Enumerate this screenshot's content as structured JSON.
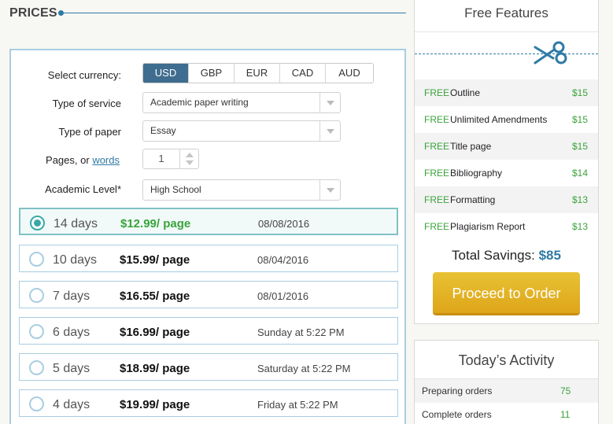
{
  "prices": {
    "title": "PRICES"
  },
  "form": {
    "currency_label": "Select currency:",
    "currencies": [
      "USD",
      "GBP",
      "EUR",
      "CAD",
      "AUD"
    ],
    "selected_currency": "USD",
    "service_label": "Type of service",
    "service_value": "Academic paper writing",
    "paper_label": "Type of paper",
    "paper_value": "Essay",
    "pages_label": "Pages, or",
    "pages_link": "words",
    "pages_value": "1",
    "level_label": "Academic Level*",
    "level_value": "High School"
  },
  "deadlines": [
    {
      "days": "14 days",
      "price": "$12.99/ page",
      "date": "08/08/2016",
      "selected": true
    },
    {
      "days": "10 days",
      "price": "$15.99/ page",
      "date": "08/04/2016",
      "selected": false
    },
    {
      "days": "7 days",
      "price": "$16.55/ page",
      "date": "08/01/2016",
      "selected": false
    },
    {
      "days": "6 days",
      "price": "$16.99/ page",
      "date": "Sunday at 5:22 PM",
      "selected": false
    },
    {
      "days": "5 days",
      "price": "$18.99/ page",
      "date": "Saturday at 5:22 PM",
      "selected": false
    },
    {
      "days": "4 days",
      "price": "$19.99/ page",
      "date": "Friday at 5:22 PM",
      "selected": false
    }
  ],
  "features": {
    "title": "Free Features",
    "icon": "scissors-icon",
    "items": [
      {
        "free": "FREE",
        "name": "Outline",
        "price": "$15"
      },
      {
        "free": "FREE",
        "name": "Unlimited Amendments",
        "price": "$15"
      },
      {
        "free": "FREE",
        "name": "Title page",
        "price": "$15"
      },
      {
        "free": "FREE",
        "name": "Bibliography",
        "price": "$14"
      },
      {
        "free": "FREE",
        "name": "Formatting",
        "price": "$13"
      },
      {
        "free": "FREE",
        "name": "Plagiarism Report",
        "price": "$13"
      }
    ],
    "savings_label": "Total Savings:",
    "savings_value": "$85",
    "order_button": "Proceed to Order"
  },
  "activity": {
    "title": "Today’s Activity",
    "items": [
      {
        "name": "Preparing orders",
        "value": "75"
      },
      {
        "name": "Complete orders",
        "value": "11"
      }
    ]
  },
  "colors": {
    "accent": "#2f7aa5",
    "green": "#3aa33a",
    "button": "#e0aa1e",
    "currency_active": "#3e6d8f"
  }
}
